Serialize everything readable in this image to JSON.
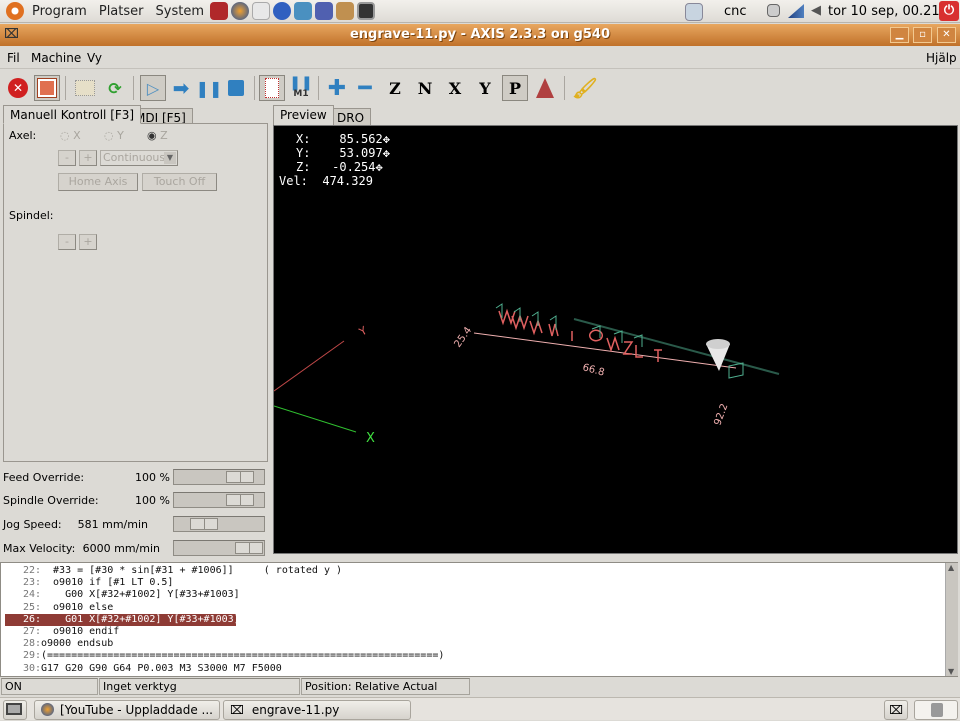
{
  "top_panel": {
    "menus": [
      "Program",
      "Platser",
      "System"
    ],
    "user": "cnc",
    "clock": "tor 10 sep, 00.21"
  },
  "window": {
    "title": "engrave-11.py - AXIS 2.3.3 on g540"
  },
  "menubar": {
    "items": [
      "Fil",
      "Machine",
      "Vy"
    ],
    "help": "Hjälp"
  },
  "toolbar": {
    "m1_label": "M1",
    "view_buttons": [
      "Z",
      "N",
      "X",
      "Y",
      "P"
    ]
  },
  "left_tabs": [
    "Manuell Kontroll [F3]",
    "MDI [F5]"
  ],
  "manual": {
    "axis_label": "Axel:",
    "axes": [
      "X",
      "Y",
      "Z"
    ],
    "selected_axis": "Z",
    "minus": "-",
    "plus": "+",
    "jog_mode": "Continuous",
    "home_axis": "Home Axis",
    "touch_off": "Touch Off",
    "spindle_label": "Spindel:"
  },
  "sliders": [
    {
      "label": "Feed Override:",
      "value": "100 %",
      "fraction": 0.85
    },
    {
      "label": "Spindle Override:",
      "value": "100 %",
      "fraction": 0.85
    },
    {
      "label": "Jog Speed:",
      "value": "581 mm/min",
      "fraction": 0.25
    },
    {
      "label": "Max Velocity:",
      "value": "6000 mm/min",
      "fraction": 1.0
    }
  ],
  "preview_tabs": [
    "Preview",
    "DRO"
  ],
  "dro": {
    "x_label": "X:",
    "x": "85.562",
    "y_label": "Y:",
    "y": "53.097",
    "z_label": "Z:",
    "z": "-0.254",
    "vel_label": "Vel:",
    "vel": "474.329"
  },
  "preview_dims": {
    "y_min": "25.4",
    "x_len": "66.8",
    "x_max": "92.2",
    "y_axis": "Y",
    "x_axis": "X"
  },
  "code_lines": [
    {
      "num": "22:",
      "text": "  #33 = [#30 * sin[#31 + #1006]]     ( rotated y )"
    },
    {
      "num": "23:",
      "text": "  o9010 if [#1 LT 0.5]"
    },
    {
      "num": "24:",
      "text": "    G00 X[#32+#1002] Y[#33+#1003]"
    },
    {
      "num": "25:",
      "text": "  o9010 else"
    },
    {
      "num": "26:",
      "text": "    G01 X[#32+#1002] Y[#33+#1003]"
    },
    {
      "num": "27:",
      "text": "  o9010 endif"
    },
    {
      "num": "28:",
      "text": "o9000 endsub"
    },
    {
      "num": "29:",
      "text": "(=================================================================)"
    },
    {
      "num": "30:",
      "text": "G17 G20 G90 G64 P0.003 M3 S3000 M7 F5000"
    }
  ],
  "highlighted_line": "26:",
  "status": {
    "state": "ON",
    "tool": "Inget verktyg",
    "position": "Position: Relative Actual"
  },
  "taskbar": {
    "tasks": [
      "[YouTube - Uppladdade ...",
      "engrave-11.py"
    ]
  },
  "colors": {
    "highlight": "#8e3b35",
    "titlebar": "#c87a34",
    "toolpath_feed": "#e06060",
    "toolpath_rapid": "#40a080"
  }
}
